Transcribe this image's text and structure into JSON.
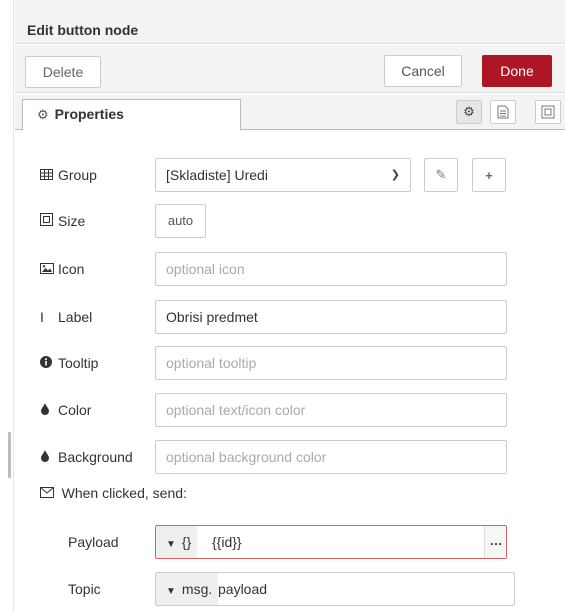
{
  "tray": {
    "title": "Edit button node"
  },
  "toolbar": {
    "delete_label": "Delete",
    "cancel_label": "Cancel",
    "done_label": "Done"
  },
  "tabs": {
    "properties_label": "Properties",
    "icons": [
      "gear-icon",
      "description-icon",
      "appearance-icon"
    ]
  },
  "form": {
    "group": {
      "label": "Group",
      "value": "[Skladiste] Uredi",
      "icon": "table-icon"
    },
    "size": {
      "label": "Size",
      "value": "auto",
      "icon": "resize-icon"
    },
    "icon_field": {
      "label": "Icon",
      "placeholder": "optional icon",
      "icon": "image-icon"
    },
    "label_field": {
      "label": "Label",
      "value": "Obrisi predmet",
      "icon": "text-cursor-icon"
    },
    "tooltip": {
      "label": "Tooltip",
      "placeholder": "optional tooltip",
      "icon": "info-icon"
    },
    "color": {
      "label": "Color",
      "placeholder": "optional text/icon color",
      "icon": "tint-icon"
    },
    "background": {
      "label": "Background",
      "placeholder": "optional background color",
      "icon": "tint-icon"
    },
    "when_clicked": {
      "label": "When clicked, send:",
      "icon": "envelope-icon"
    },
    "payload": {
      "label": "Payload",
      "type": "{}",
      "value": "{{id}}",
      "expand": "…"
    },
    "topic": {
      "label": "Topic",
      "type": "msg.",
      "value": "payload"
    }
  },
  "colors": {
    "done": "#ad1625",
    "error_border": "#d6615f"
  }
}
